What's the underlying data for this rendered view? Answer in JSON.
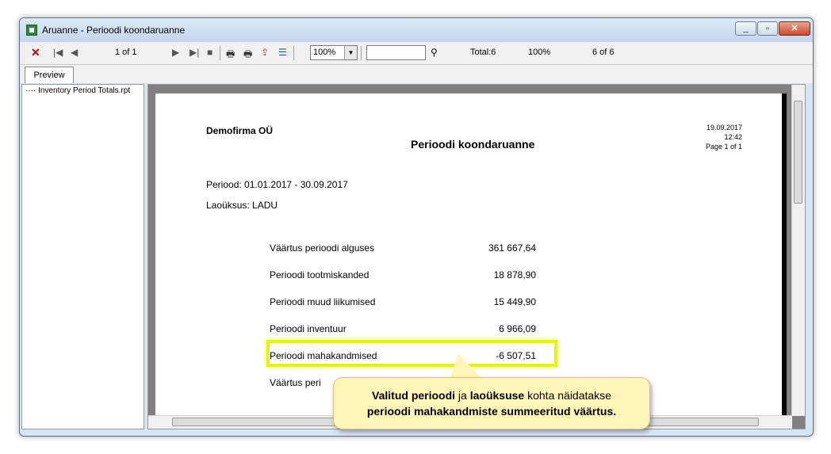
{
  "window": {
    "title": "Aruanne - Perioodi koondaruanne"
  },
  "toolbar": {
    "close_icon_glyph": "✕",
    "page_counter": "1 of 1",
    "zoom_value": "100%",
    "search_value": "",
    "total_label": "Total:6",
    "percent_label": "100%",
    "record_label": "6 of 6"
  },
  "tabs": [
    {
      "label": "Preview"
    }
  ],
  "tree": {
    "items": [
      "Inventory Period Totals.rpt"
    ]
  },
  "report": {
    "company": "Demofirma OÜ",
    "title": "Perioodi koondaruanne",
    "date": "19.09.2017",
    "time": "12:42",
    "page": "Page 1 of 1",
    "period": "Periood: 01.01.2017 - 30.09.2017",
    "warehouse": "Laoüksus: LADU",
    "rows": [
      {
        "label": "Väärtus perioodi alguses",
        "value": "361 667,64"
      },
      {
        "label": "Perioodi tootmiskanded",
        "value": "18 878,90"
      },
      {
        "label": "Perioodi muud liikumised",
        "value": "15 449,90"
      },
      {
        "label": "Perioodi inventuur",
        "value": "6 966,09"
      },
      {
        "label": "Perioodi mahakandmised",
        "value": "-6 507,51"
      },
      {
        "label": "Väärtus peri",
        "value": ""
      }
    ]
  },
  "callout": {
    "part1": "Valitud perioodi",
    "part2": " ja ",
    "part3": "laoüksuse",
    "part4": " kohta näidatakse",
    "line2": "perioodi mahakandmiste summeeritud väärtus."
  },
  "colors": {
    "highlight": "#e6f01f",
    "callout_bg": "#fff5b8",
    "close_red": "#c9482d"
  }
}
